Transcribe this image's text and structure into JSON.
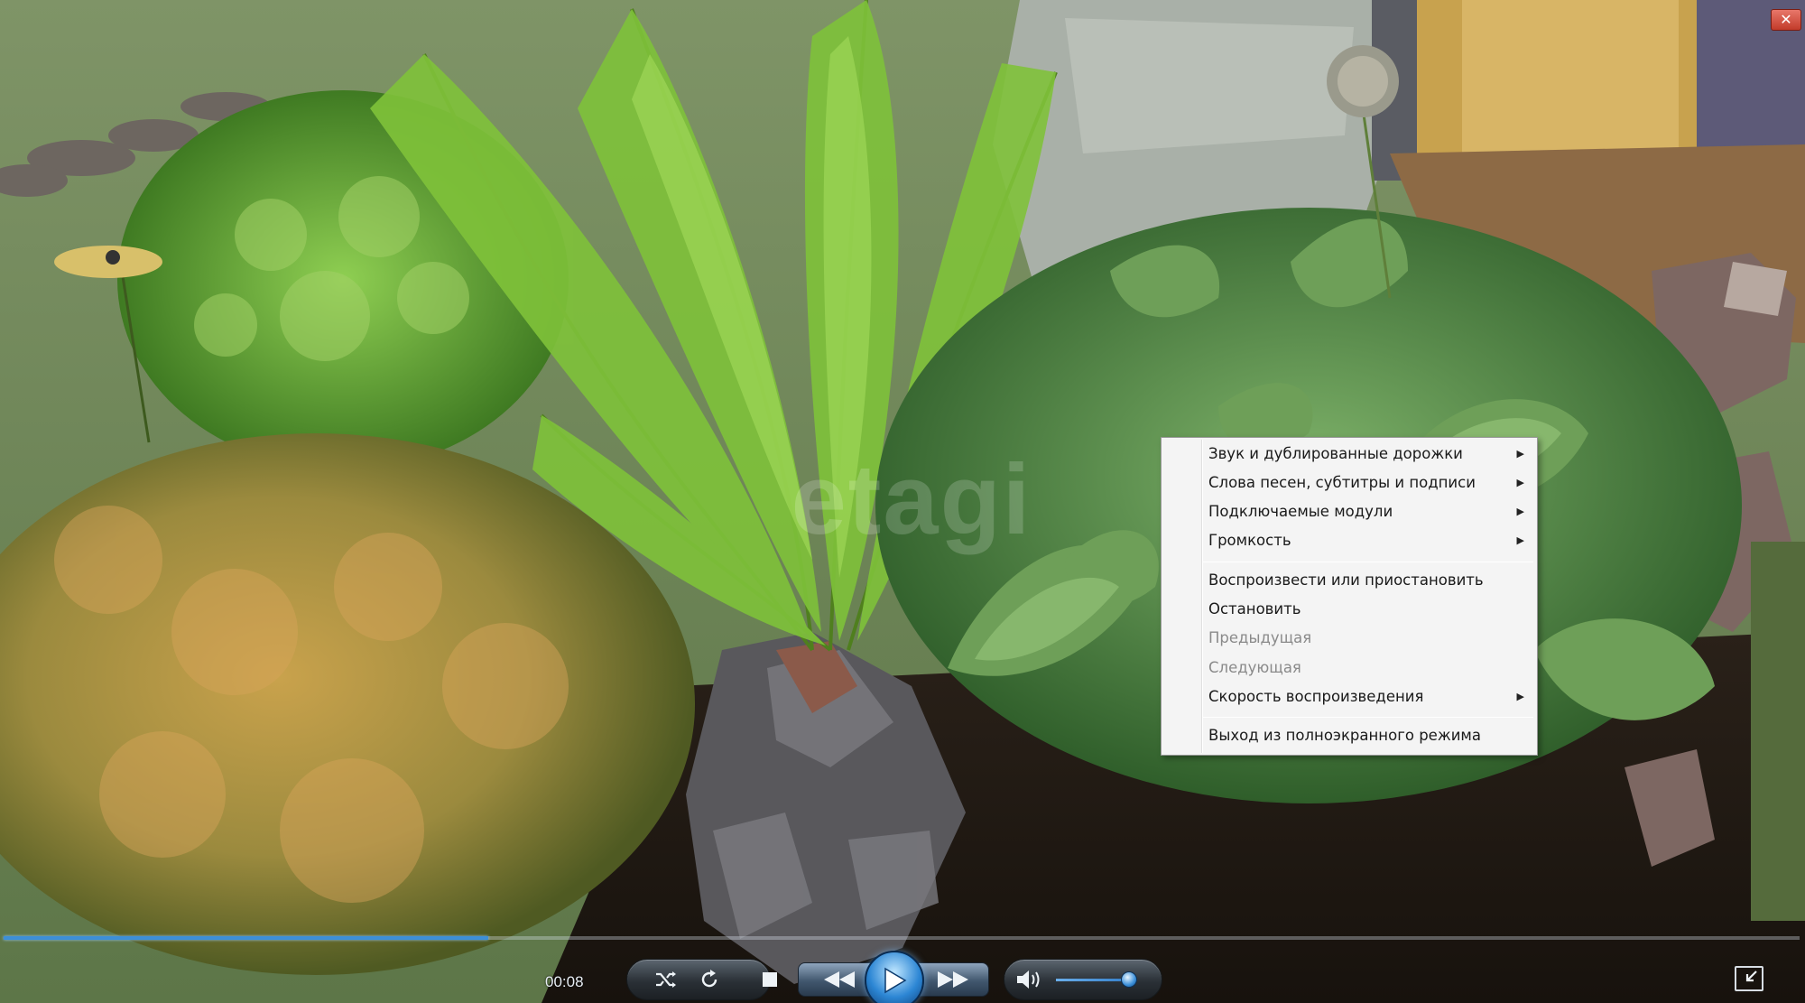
{
  "window": {
    "close_glyph": "✕",
    "watermark": "etagi"
  },
  "context_menu": {
    "items": [
      {
        "label": "Звук и дублированные дорожки",
        "submenu": true,
        "enabled": true
      },
      {
        "label": "Слова песен, субтитры и подписи",
        "submenu": true,
        "enabled": true
      },
      {
        "label": "Подключаемые модули",
        "submenu": true,
        "enabled": true
      },
      {
        "label": "Громкость",
        "submenu": true,
        "enabled": true
      },
      {
        "label": "Воспроизвести или приостановить",
        "submenu": false,
        "enabled": true
      },
      {
        "label": "Остановить",
        "submenu": false,
        "enabled": true
      },
      {
        "label": "Предыдущая",
        "submenu": false,
        "enabled": false
      },
      {
        "label": "Следующая",
        "submenu": false,
        "enabled": false
      },
      {
        "label": "Скорость воспроизведения",
        "submenu": true,
        "enabled": true
      },
      {
        "label": "Выход из полноэкранного режима",
        "submenu": false,
        "enabled": true
      }
    ],
    "submenu_arrow": "▶"
  },
  "player": {
    "current_time": "00:08",
    "progress_fraction": 0.27,
    "volume_fraction": 0.9,
    "icons": {
      "shuffle": "shuffle-icon",
      "repeat": "repeat-icon",
      "stop": "stop-icon",
      "previous": "rewind-icon",
      "play": "play-icon",
      "next": "fast-forward-icon",
      "volume": "speaker-icon",
      "exit_fullscreen": "exit-fullscreen-icon"
    },
    "accent_color": "#3d8fd8"
  }
}
